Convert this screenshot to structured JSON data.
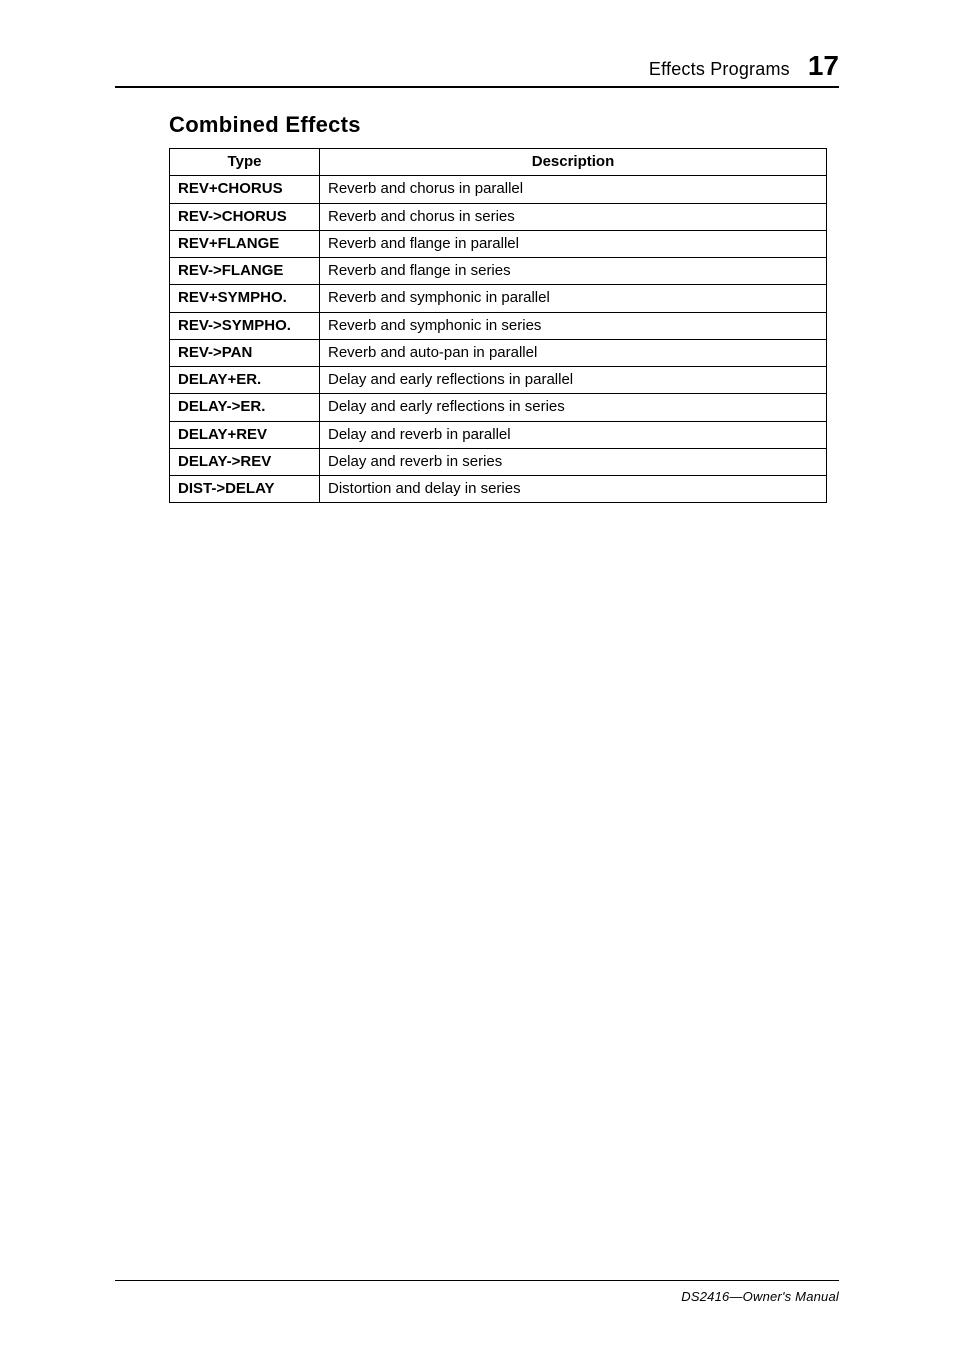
{
  "header": {
    "section": "Effects Programs",
    "page_number": "17"
  },
  "section_title": "Combined Effects",
  "table": {
    "col_type_header": "Type",
    "col_desc_header": "Description",
    "rows": [
      {
        "type": "REV+CHORUS",
        "desc": "Reverb and chorus in parallel"
      },
      {
        "type": "REV->CHORUS",
        "desc": "Reverb and chorus in series"
      },
      {
        "type": "REV+FLANGE",
        "desc": "Reverb and flange in parallel"
      },
      {
        "type": "REV->FLANGE",
        "desc": "Reverb and flange in series"
      },
      {
        "type": "REV+SYMPHO.",
        "desc": "Reverb and symphonic in parallel"
      },
      {
        "type": "REV->SYMPHO.",
        "desc": "Reverb and symphonic in series"
      },
      {
        "type": "REV->PAN",
        "desc": "Reverb and auto-pan in parallel"
      },
      {
        "type": "DELAY+ER.",
        "desc": "Delay and early reflections in parallel"
      },
      {
        "type": "DELAY->ER.",
        "desc": "Delay and early reflections in series"
      },
      {
        "type": "DELAY+REV",
        "desc": "Delay and reverb in parallel"
      },
      {
        "type": "DELAY->REV",
        "desc": "Delay and reverb in series"
      },
      {
        "type": "DIST->DELAY",
        "desc": "Distortion and delay in series"
      }
    ]
  },
  "footer": {
    "owner": "DS2416—Owner's Manual"
  }
}
